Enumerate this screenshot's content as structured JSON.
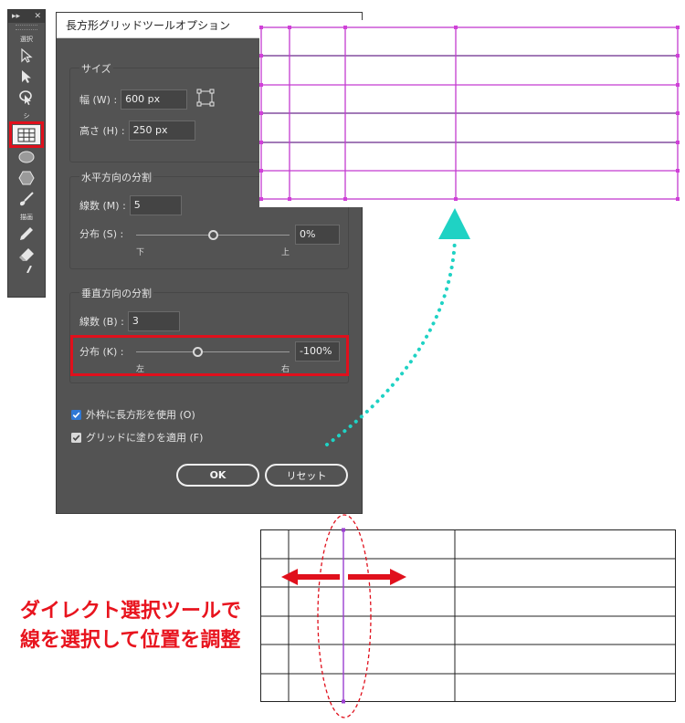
{
  "toolbar": {
    "sections": [
      "選択",
      "シ",
      "描画"
    ],
    "tools": [
      "selection-tool",
      "direct-selection-tool",
      "group-selection-tool",
      "rectangular-grid-tool",
      "ellipse-tool",
      "polygon-tool",
      "brush-tool",
      "pencil-tool",
      "eraser-tool"
    ]
  },
  "dialog": {
    "title": "長方形グリッドツールオプション",
    "size": {
      "title": "サイズ",
      "width_label": "幅 (W) :",
      "width_value": "600 px",
      "height_label": "高さ (H) :",
      "height_value": "250 px"
    },
    "horizontal": {
      "title": "水平方向の分割",
      "count_label": "線数 (M) :",
      "count_value": "5",
      "skew_label": "分布 (S) :",
      "skew_value": "0%",
      "skew_fraction": 0.5,
      "left_tick": "下",
      "right_tick": "上"
    },
    "vertical": {
      "title": "垂直方向の分割",
      "count_label": "線数 (B) :",
      "count_value": "3",
      "skew_label": "分布 (K) :",
      "skew_value": "-100%",
      "skew_fraction": 0.4,
      "left_tick": "左",
      "right_tick": "右"
    },
    "options": {
      "outer_rect_label": "外枠に長方形を使用 (O)",
      "outer_rect_checked": true,
      "fill_grid_label": "グリッドに塗りを適用 (F)",
      "fill_grid_checked": true
    },
    "buttons": {
      "ok": "OK",
      "reset": "リセット"
    }
  },
  "annotation": {
    "line1": "ダイレクト選択ツールで",
    "line2": "線を選択して位置を調整"
  },
  "colors": {
    "accent_red": "#e0101c",
    "grid_magenta": "#d040d8",
    "arrow_teal": "#1fd2c4",
    "panel_gray": "#535353"
  }
}
